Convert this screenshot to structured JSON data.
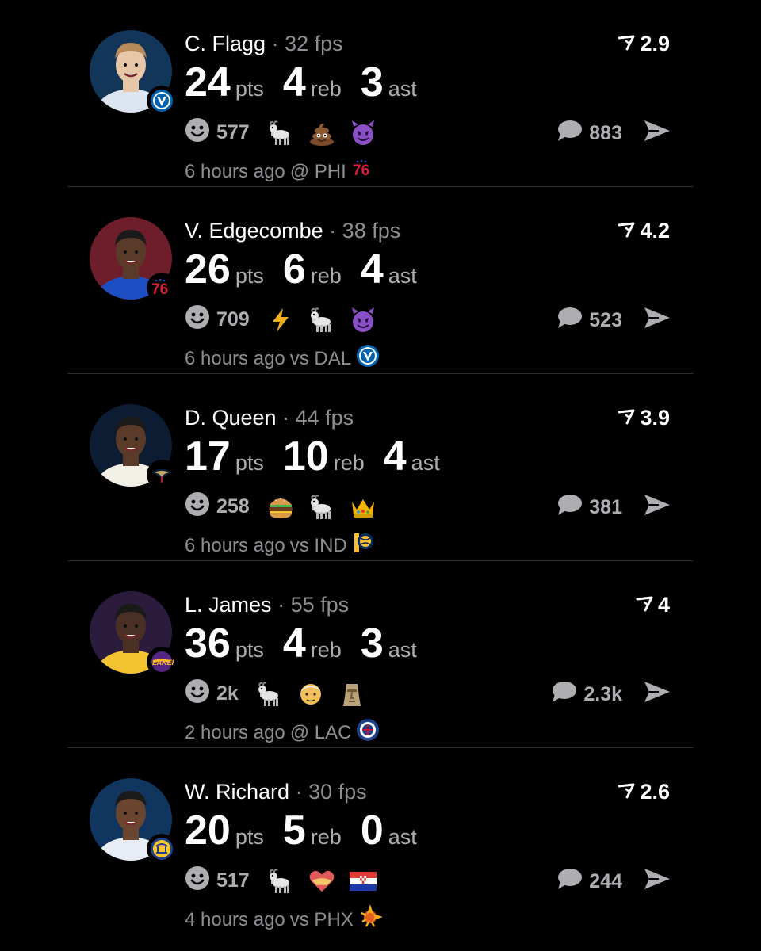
{
  "posts": [
    {
      "name": "C. Flagg",
      "fps": "32 fps",
      "rating": "2.9",
      "stats": [
        {
          "value": "24",
          "label": "pts"
        },
        {
          "value": "4",
          "label": "reb"
        },
        {
          "value": "3",
          "label": "ast"
        }
      ],
      "reaction_count": "577",
      "emojis": [
        "goat",
        "poop",
        "smiling-devil"
      ],
      "comments": "883",
      "time": "6 hours ago",
      "venue": "@ PHI",
      "team": "mavericks",
      "opponent": "76ers"
    },
    {
      "name": "V. Edgecombe",
      "fps": "38 fps",
      "rating": "4.2",
      "stats": [
        {
          "value": "26",
          "label": "pts"
        },
        {
          "value": "6",
          "label": "reb"
        },
        {
          "value": "4",
          "label": "ast"
        }
      ],
      "reaction_count": "709",
      "emojis": [
        "lightning",
        "goat",
        "smiling-devil"
      ],
      "comments": "523",
      "time": "6 hours ago",
      "venue": "vs DAL",
      "team": "76ers",
      "opponent": "mavericks"
    },
    {
      "name": "D. Queen",
      "fps": "44 fps",
      "rating": "3.9",
      "stats": [
        {
          "value": "17",
          "label": "pts"
        },
        {
          "value": "10",
          "label": "reb"
        },
        {
          "value": "4",
          "label": "ast"
        }
      ],
      "reaction_count": "258",
      "emojis": [
        "burger",
        "goat",
        "crown"
      ],
      "comments": "381",
      "time": "6 hours ago",
      "venue": "vs IND",
      "team": "pelicans",
      "opponent": "pacers"
    },
    {
      "name": "L. James",
      "fps": "55 fps",
      "rating": "4",
      "stats": [
        {
          "value": "36",
          "label": "pts"
        },
        {
          "value": "4",
          "label": "reb"
        },
        {
          "value": "3",
          "label": "ast"
        }
      ],
      "reaction_count": "2k",
      "emojis": [
        "goat",
        "old-man",
        "moai"
      ],
      "comments": "2.3k",
      "time": "2 hours ago",
      "venue": "@ LAC",
      "team": "lakers",
      "opponent": "clippers"
    },
    {
      "name": "W. Richard",
      "fps": "30 fps",
      "rating": "2.6",
      "stats": [
        {
          "value": "20",
          "label": "pts"
        },
        {
          "value": "5",
          "label": "reb"
        },
        {
          "value": "0",
          "label": "ast"
        }
      ],
      "reaction_count": "517",
      "emojis": [
        "goat",
        "heart",
        "croatia-flag"
      ],
      "comments": "244",
      "time": "4 hours ago",
      "venue": "vs PHX",
      "team": "warriors",
      "opponent": "suns"
    }
  ],
  "name_separator": "·",
  "colors": {
    "background": "#000000",
    "secondary_text": "#8e8e93",
    "icon_gray": "#aeaeb2",
    "avatar_bg": [
      "#12355a",
      "#6e1e2b",
      "#0c1c33",
      "#2b1c3e",
      "#10355e"
    ]
  }
}
